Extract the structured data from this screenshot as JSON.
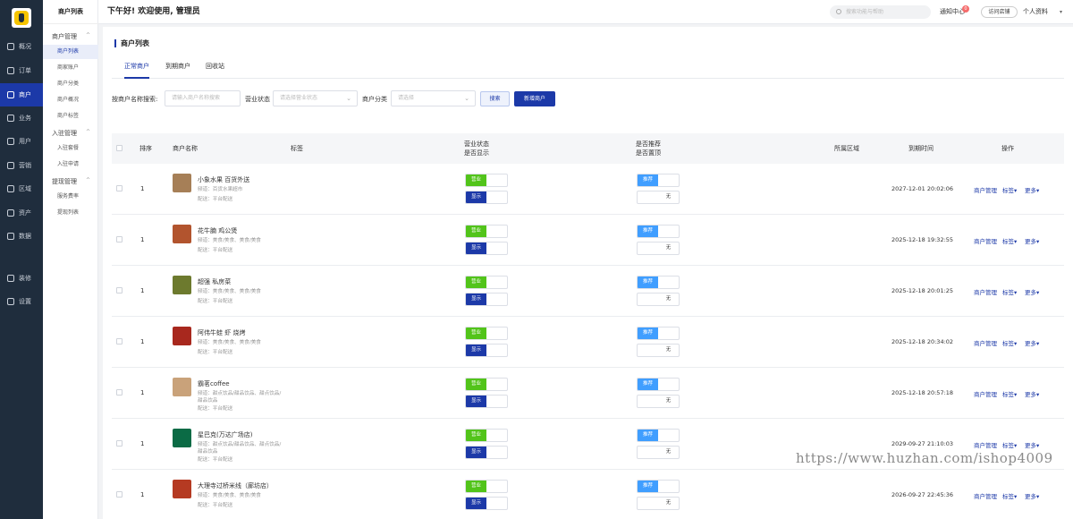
{
  "rail": {
    "items": [
      {
        "label": "概况",
        "icon": "overview-icon"
      },
      {
        "label": "订单",
        "icon": "order-icon"
      },
      {
        "label": "商户",
        "icon": "merchant-icon",
        "active": true
      },
      {
        "label": "业务",
        "icon": "business-icon"
      },
      {
        "label": "用户",
        "icon": "user-icon"
      },
      {
        "label": "营销",
        "icon": "marketing-icon"
      },
      {
        "label": "区域",
        "icon": "region-icon"
      },
      {
        "label": "资产",
        "icon": "asset-icon"
      },
      {
        "label": "数据",
        "icon": "data-icon"
      },
      {
        "label": "装修",
        "icon": "decorate-icon"
      },
      {
        "label": "设置",
        "icon": "settings-icon"
      }
    ]
  },
  "submenu": {
    "title": "商户列表",
    "group1": "商户管理",
    "group1_items": [
      "商户列表",
      "商家账户",
      "商户分类",
      "商户概况",
      "商户标签"
    ],
    "group2": "入驻管理",
    "group2_items": [
      "入驻套餐",
      "入驻申请"
    ],
    "group3": "提现管理",
    "group3_items": [
      "服务费率",
      "提现列表"
    ]
  },
  "topbar": {
    "greeting": "下午好! 欢迎使用, 管理员",
    "search_placeholder": "搜索功能与帮助",
    "notice_label": "通知中心",
    "notice_count": "0",
    "visit_store": "访问店铺",
    "profile": "个人资料"
  },
  "page": {
    "title": "商户列表",
    "tabs": [
      "正常商户",
      "到期商户",
      "回收站"
    ],
    "filter": {
      "name_label": "按商户名称搜索:",
      "name_placeholder": "请输入商户名称搜索",
      "status_label": "营业状态",
      "status_placeholder": "请选择营业状态",
      "category_label": "商户分类",
      "category_placeholder": "请选择",
      "search_button": "搜索",
      "add_button": "新增商户"
    }
  },
  "table": {
    "headers": {
      "sort": "排序",
      "name": "商户名称",
      "tag": "标签",
      "status_line1": "营业状态",
      "status_line2": "是否显示",
      "rec_line1": "是否推荐",
      "rec_line2": "是否置顶",
      "region": "所属区域",
      "expire": "到期时间",
      "action": "操作"
    },
    "labels": {
      "open": "营业",
      "show": "显示",
      "recommend": "推荐",
      "none": "无",
      "manage": "商户管理",
      "tag": "标签▾",
      "more": "更多▾"
    },
    "rows": [
      {
        "sort": "1",
        "name": "小象水果 百货外送",
        "category": "频道：百货水果超市",
        "delivery": "配送：平台配送",
        "expire": "2027-12-01 20:02:06",
        "thumb": "#a67f57"
      },
      {
        "sort": "1",
        "name": "花牛腩 鸡公煲",
        "category": "频道：美食/美食、美食/美食",
        "delivery": "配送：平台配送",
        "expire": "2025-12-18 19:32:55",
        "thumb": "#b2542e"
      },
      {
        "sort": "1",
        "name": "超强 私房菜",
        "category": "频道：美食/美食、美食/美食",
        "delivery": "配送：平台配送",
        "expire": "2025-12-18 20:01:25",
        "thumb": "#6d7a2e"
      },
      {
        "sort": "1",
        "name": "阿伟牛蛙 虾 烧烤",
        "category": "频道：美食/美食、美食/美食",
        "delivery": "配送：平台配送",
        "expire": "2025-12-18 20:34:02",
        "thumb": "#a8281e"
      },
      {
        "sort": "1",
        "name": "霸茗coffee",
        "category": "频道：甜点饮品/甜品饮品、甜点饮品/甜品饮品",
        "delivery": "配送：平台配送",
        "expire": "2025-12-18 20:57:18",
        "thumb": "#c9a27a"
      },
      {
        "sort": "1",
        "name": "星巴克(万达广场店)",
        "category": "频道：甜点饮品/甜品饮品、甜点饮品/甜品饮品",
        "delivery": "配送：平台配送",
        "expire": "2029-09-27 21:10:03",
        "thumb": "#0b6b45"
      },
      {
        "sort": "1",
        "name": "大理寺过桥米线（廊坊店）",
        "category": "频道：美食/美食、美食/美食",
        "delivery": "配送：平台配送",
        "expire": "2026-09-27 22:45:36",
        "thumb": "#b53a22"
      }
    ]
  },
  "watermark": "https://www.huzhan.com/ishop4009",
  "colors": {
    "primary": "#1c39a8",
    "rail_bg": "#1f2d3d",
    "open_green": "#52c41a",
    "recommend_blue": "#409eff"
  }
}
